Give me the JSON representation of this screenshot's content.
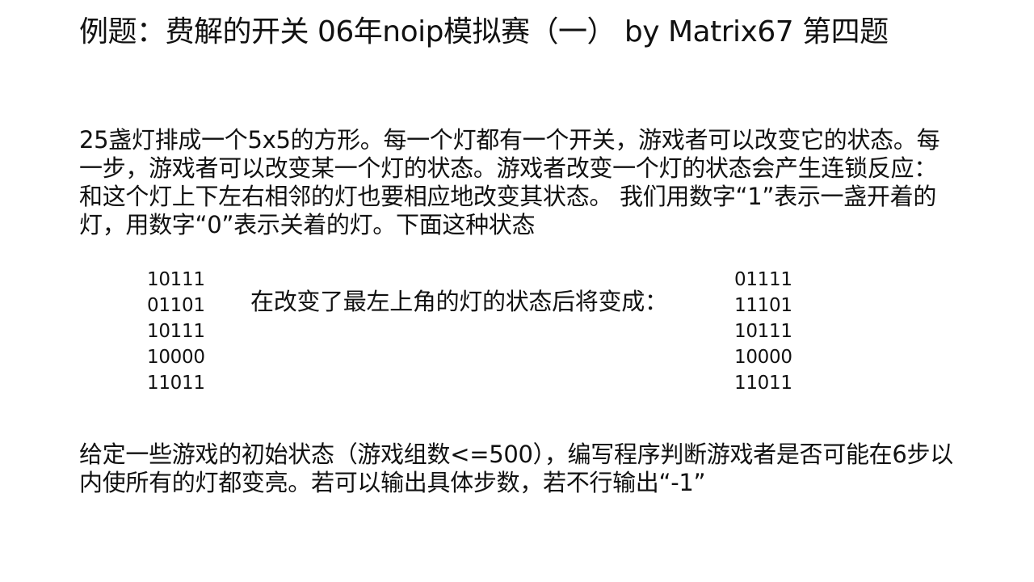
{
  "slide": {
    "title": "例题：费解的开关 06年noip模拟赛（一） by Matrix67 第四题",
    "intro": "25盏灯排成一个5x5的方形。每一个灯都有一个开关，游戏者可以改变它的状态。每一步，游戏者可以改变某一个灯的状态。游戏者改变一个灯的状态会产生连锁反应：和这个灯上下左右相邻的灯也要相应地改变其状态。 我们用数字“1”表示一盏开着的灯，用数字“0”表示关着的灯。下面这种状态",
    "grid_before": [
      "10111",
      "01101",
      "10111",
      "10000",
      "11011"
    ],
    "transition_text": "在改变了最左上角的灯的状态后将变成：",
    "grid_after": [
      "01111",
      "11101",
      "10111",
      "10000",
      "11011"
    ],
    "task": "给定一些游戏的初始状态（游戏组数<=500），编写程序判断游戏者是否可能在6步以内使所有的灯都变亮。若可以输出具体步数，若不行输出“-1”"
  }
}
